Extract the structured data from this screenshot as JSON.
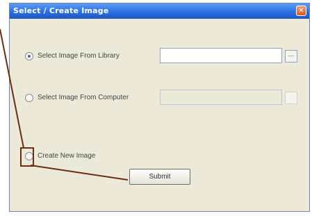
{
  "dialog": {
    "title": "Select / Create Image",
    "close_glyph": "✕"
  },
  "options": [
    {
      "label": "Select Image From Library",
      "checked": true
    },
    {
      "label": "Select Image From Computer",
      "checked": false
    },
    {
      "label": "Create New Image",
      "checked": false
    }
  ],
  "library_field": {
    "value": ""
  },
  "computer_field": {
    "value": ""
  },
  "browse_glyph": "...",
  "submit_label": "Submit",
  "callout": {
    "color": "#6b2c12"
  }
}
